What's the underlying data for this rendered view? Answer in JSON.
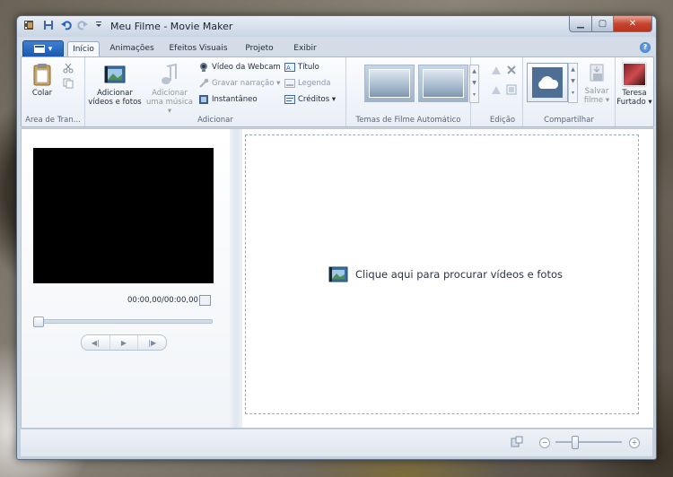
{
  "window": {
    "title": "Meu Filme - Movie Maker"
  },
  "tabs": [
    {
      "label": "Início",
      "active": true
    },
    {
      "label": "Animações"
    },
    {
      "label": "Efeitos Visuais"
    },
    {
      "label": "Projeto"
    },
    {
      "label": "Exibir"
    }
  ],
  "help": "?",
  "ribbon": {
    "clipboard": {
      "paste": "Colar",
      "group": "Área de Tran..."
    },
    "add": {
      "add_videos_l1": "Adicionar",
      "add_videos_l2": "vídeos e fotos",
      "add_music_l1": "Adicionar",
      "add_music_l2": "uma música ▾",
      "webcam": "Vídeo da Webcam",
      "narration": "Gravar narração ▾",
      "snapshot": "Instantâneo",
      "title": "Título",
      "caption": "Legenda",
      "credits": "Créditos ▾",
      "group": "Adicionar"
    },
    "themes": {
      "group": "Temas de Filme Automático"
    },
    "edit": {
      "group": "Edição"
    },
    "share": {
      "save_l1": "Salvar",
      "save_l2": "filme ▾",
      "user_l1": "Teresa",
      "user_l2": "Furtado ▾",
      "group": "Compartilhar"
    }
  },
  "player": {
    "time": "00:00,00/00:00,00"
  },
  "storyboard": {
    "prompt": "Clique aqui para procurar vídeos e fotos"
  },
  "colors": {
    "accent": "#1b58b0",
    "close": "#c7452f"
  }
}
